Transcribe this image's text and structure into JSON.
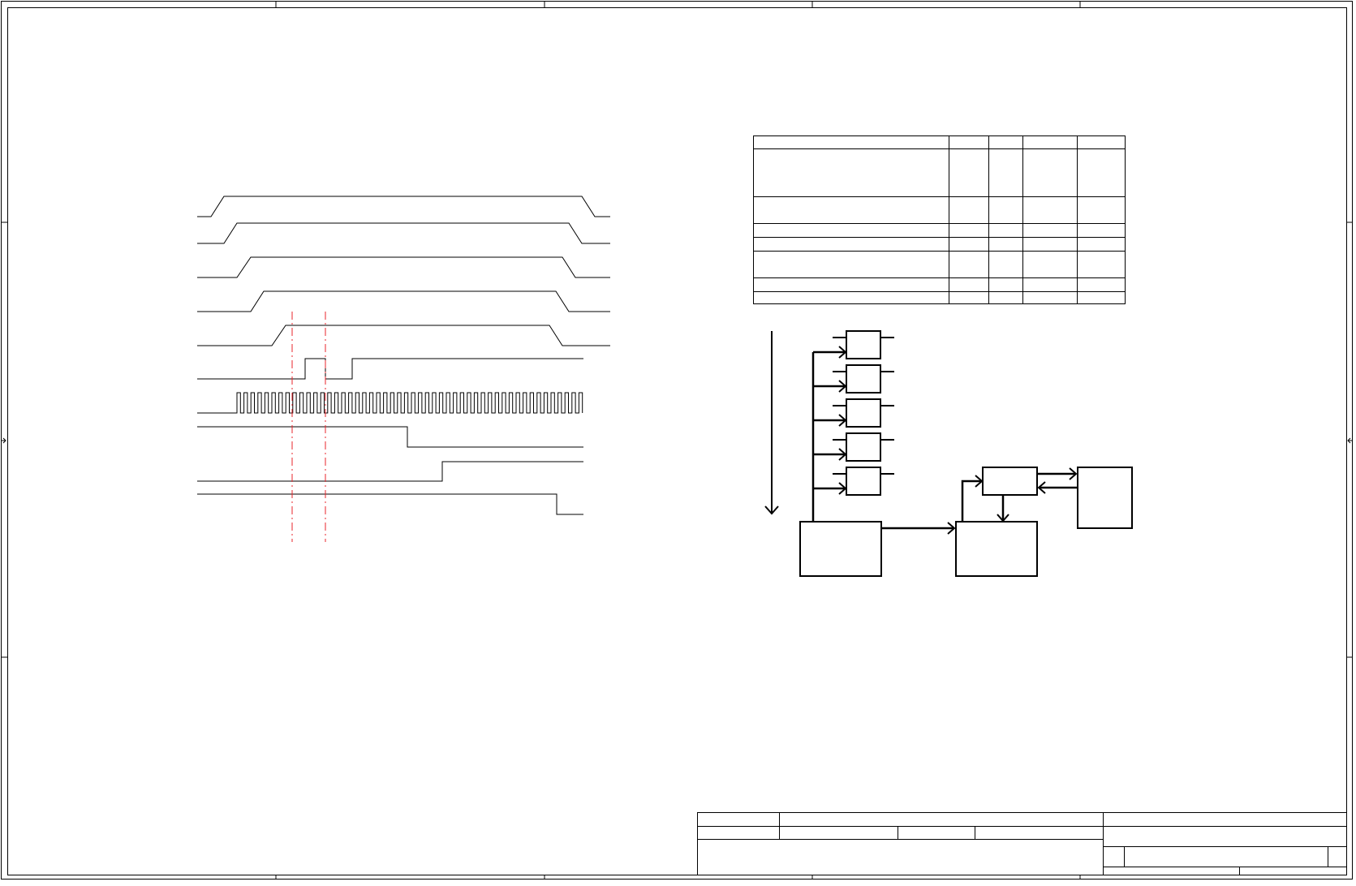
{
  "sheet": {
    "frame": "drawing-frame",
    "zone_markers": "border-tick-marks"
  },
  "timing_diagram": {
    "signals": [
      {
        "kind": "rail"
      },
      {
        "kind": "rail"
      },
      {
        "kind": "rail"
      },
      {
        "kind": "rail"
      },
      {
        "kind": "rail"
      },
      {
        "kind": "pulse"
      },
      {
        "kind": "clock"
      },
      {
        "kind": "falling-step"
      },
      {
        "kind": "rising-step"
      },
      {
        "kind": "falling-step"
      }
    ],
    "marker_color": "#e8252b",
    "marker_count": 2
  },
  "block_diagram": {
    "small_blocks": 5,
    "large_blocks": 3,
    "side_block": 1
  },
  "spec_table": {
    "columns": 5,
    "rows": 7
  },
  "title_block": {
    "present": true
  },
  "colors": {
    "ink": "#000000",
    "marker": "#e8252b",
    "paper": "#ffffff"
  }
}
